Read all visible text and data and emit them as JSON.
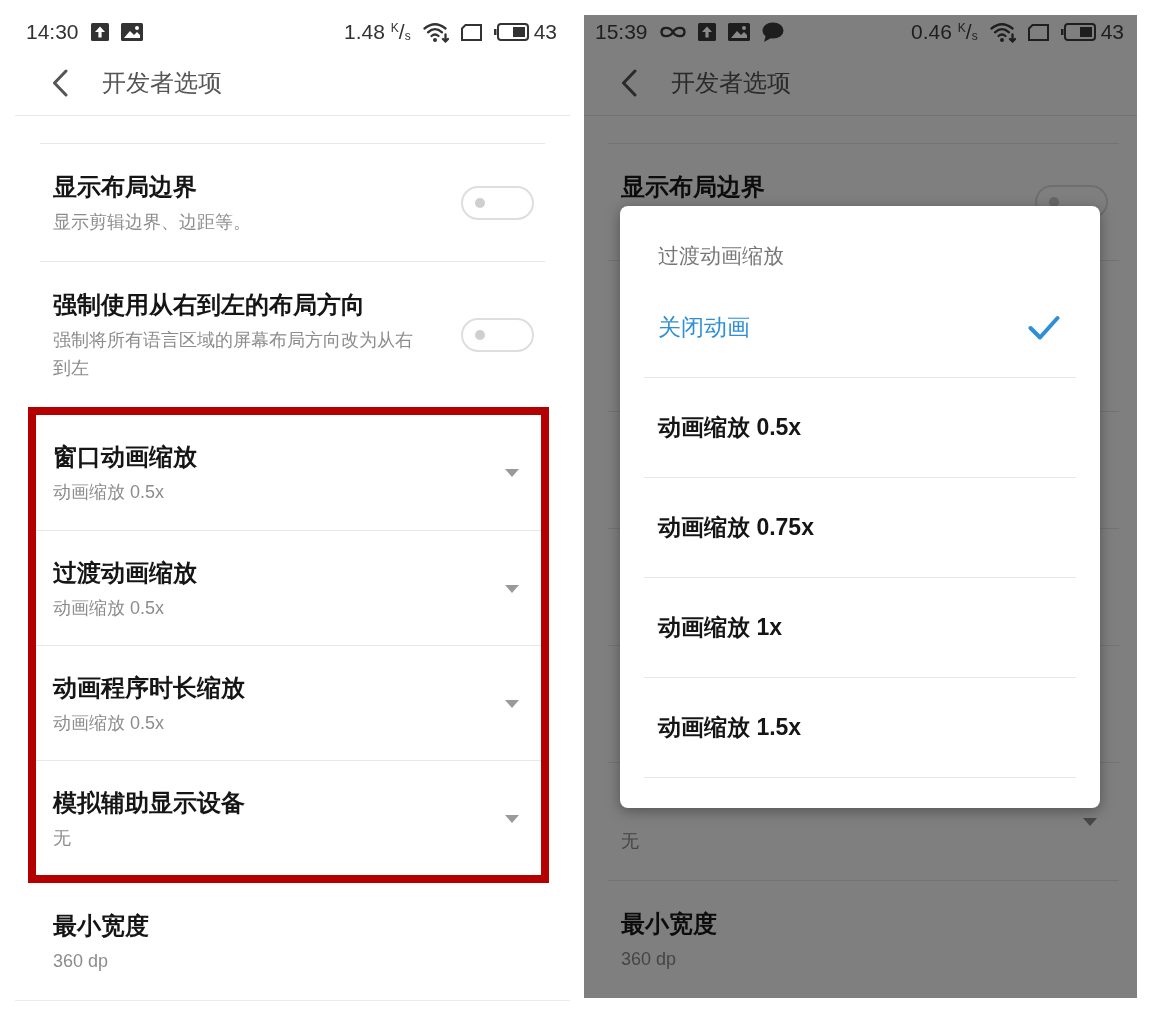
{
  "screens": [
    {
      "dimmed": false,
      "status_bar": {
        "time": "14:30",
        "icons": [
          {
            "kind": "upload"
          },
          {
            "kind": "image"
          }
        ],
        "speed": "1.48 $^{K}$/$_{s}$",
        "battery": "43"
      },
      "header": {
        "title": "开发者选项"
      },
      "sections": [
        {
          "highlighted": false,
          "rows": [
            {
              "kind": "toggle",
              "title": "显示布局边界",
              "summary": "显示剪辑边界、边距等。",
              "on": false
            },
            {
              "kind": "toggle",
              "title": "强制使用从右到左的布局方向",
              "summary": "强制将所有语言区域的屏幕布局方向改为从右到左",
              "on": false
            }
          ]
        },
        {
          "highlighted": true,
          "rows": [
            {
              "kind": "dropdown",
              "title": "窗口动画缩放",
              "summary": "动画缩放 0.5x"
            },
            {
              "kind": "dropdown",
              "title": "过渡动画缩放",
              "summary": "动画缩放 0.5x"
            },
            {
              "kind": "dropdown",
              "title": "动画程序时长缩放",
              "summary": "动画缩放 0.5x"
            },
            {
              "kind": "dropdown",
              "title": "模拟辅助显示设备",
              "summary": "无"
            }
          ]
        },
        {
          "highlighted": false,
          "rows": [
            {
              "kind": "plain",
              "title": "最小宽度",
              "summary": "360 dp"
            }
          ]
        }
      ]
    },
    {
      "dimmed": true,
      "status_bar": {
        "time": "15:39",
        "icons": [
          {
            "kind": "infinity"
          },
          {
            "kind": "upload"
          },
          {
            "kind": "image"
          },
          {
            "kind": "chat"
          }
        ],
        "speed": "0.46 $^{K}$/$_{s}$",
        "battery": "43"
      },
      "header": {
        "title": "开发者选项"
      },
      "sections": [
        {
          "highlighted": false,
          "rows": [
            {
              "kind": "toggle",
              "title": "显示布局边界",
              "on": false,
              "covered": false
            },
            {
              "covered": true
            },
            {
              "covered": true
            },
            {
              "covered": true
            },
            {
              "covered": true
            },
            {
              "kind": "dropdown",
              "summary": "无",
              "covered": false
            },
            {
              "kind": "plain",
              "title": "最小宽度",
              "summary": "360 dp",
              "covered": false
            }
          ]
        }
      ],
      "dialog": {
        "title": "过渡动画缩放",
        "options": [
          {
            "label": "关闭动画",
            "selected": true
          },
          {
            "label": "动画缩放 0.5x",
            "selected": false
          },
          {
            "label": "动画缩放 0.75x",
            "selected": false
          },
          {
            "label": "动画缩放 1x",
            "selected": false
          },
          {
            "label": "动画缩放 1.5x",
            "selected": false
          }
        ]
      }
    }
  ]
}
